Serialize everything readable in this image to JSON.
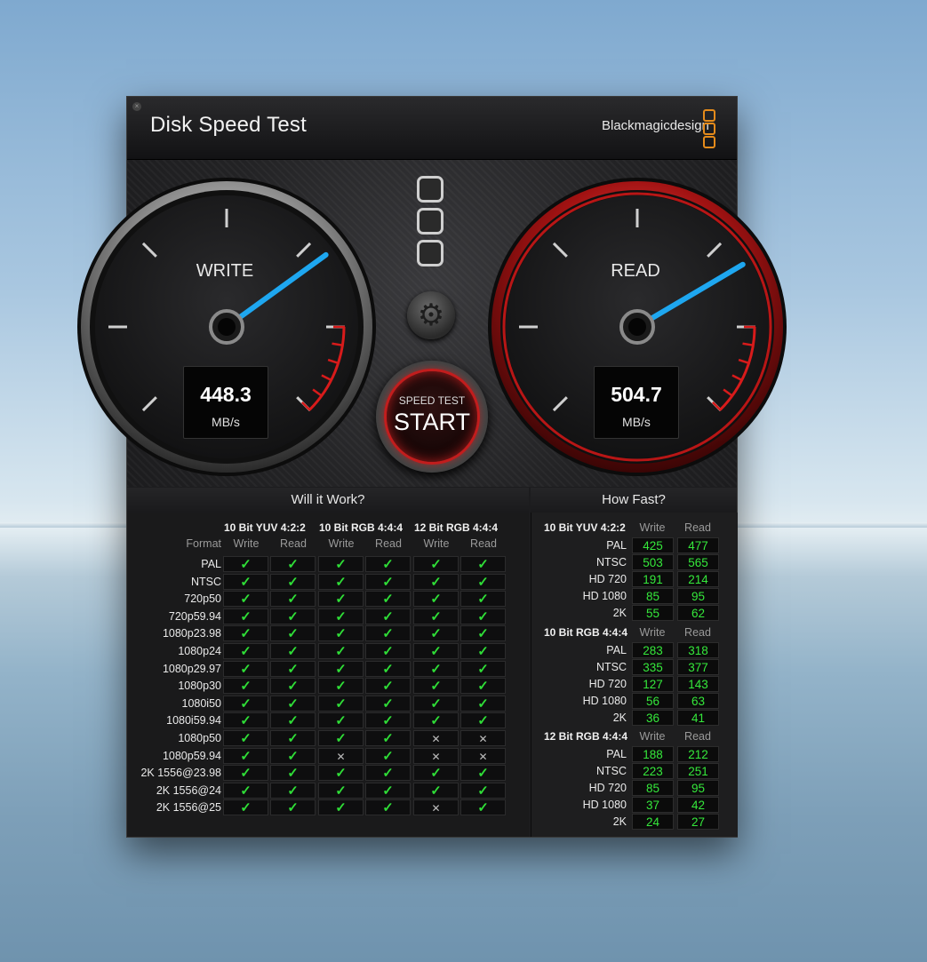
{
  "app": {
    "title": "Disk Speed Test",
    "brand": "Blackmagicdesign"
  },
  "gauges": {
    "write": {
      "label": "WRITE",
      "value": "448.3",
      "unit": "MB/s",
      "needle_fraction": 0.7
    },
    "read": {
      "label": "READ",
      "value": "504.7",
      "unit": "MB/s",
      "needle_fraction": 0.72
    }
  },
  "start_button": {
    "small_label": "SPEED TEST",
    "big_label": "START"
  },
  "will_it_work": {
    "title": "Will it Work?",
    "format_label": "Format",
    "groups": [
      "10 Bit YUV 4:2:2",
      "10 Bit RGB 4:4:4",
      "12 Bit RGB 4:4:4"
    ],
    "sub_labels": [
      "Write",
      "Read"
    ],
    "rows": [
      {
        "format": "PAL",
        "results": [
          true,
          true,
          true,
          true,
          true,
          true
        ]
      },
      {
        "format": "NTSC",
        "results": [
          true,
          true,
          true,
          true,
          true,
          true
        ]
      },
      {
        "format": "720p50",
        "results": [
          true,
          true,
          true,
          true,
          true,
          true
        ]
      },
      {
        "format": "720p59.94",
        "results": [
          true,
          true,
          true,
          true,
          true,
          true
        ]
      },
      {
        "format": "1080p23.98",
        "results": [
          true,
          true,
          true,
          true,
          true,
          true
        ]
      },
      {
        "format": "1080p24",
        "results": [
          true,
          true,
          true,
          true,
          true,
          true
        ]
      },
      {
        "format": "1080p29.97",
        "results": [
          true,
          true,
          true,
          true,
          true,
          true
        ]
      },
      {
        "format": "1080p30",
        "results": [
          true,
          true,
          true,
          true,
          true,
          true
        ]
      },
      {
        "format": "1080i50",
        "results": [
          true,
          true,
          true,
          true,
          true,
          true
        ]
      },
      {
        "format": "1080i59.94",
        "results": [
          true,
          true,
          true,
          true,
          true,
          true
        ]
      },
      {
        "format": "1080p50",
        "results": [
          true,
          true,
          true,
          true,
          false,
          false
        ]
      },
      {
        "format": "1080p59.94",
        "results": [
          true,
          true,
          false,
          true,
          false,
          false
        ]
      },
      {
        "format": "2K 1556@23.98",
        "results": [
          true,
          true,
          true,
          true,
          true,
          true
        ]
      },
      {
        "format": "2K 1556@24",
        "results": [
          true,
          true,
          true,
          true,
          true,
          true
        ]
      },
      {
        "format": "2K 1556@25",
        "results": [
          true,
          true,
          true,
          true,
          false,
          true
        ]
      }
    ],
    "ok_glyph": "✓",
    "fail_glyph": "✕"
  },
  "how_fast": {
    "title": "How Fast?",
    "sub_labels": [
      "Write",
      "Read"
    ],
    "groups": [
      {
        "name": "10 Bit YUV 4:2:2",
        "rows": [
          {
            "format": "PAL",
            "write": "425",
            "read": "477"
          },
          {
            "format": "NTSC",
            "write": "503",
            "read": "565"
          },
          {
            "format": "HD 720",
            "write": "191",
            "read": "214"
          },
          {
            "format": "HD 1080",
            "write": "85",
            "read": "95"
          },
          {
            "format": "2K",
            "write": "55",
            "read": "62"
          }
        ]
      },
      {
        "name": "10 Bit RGB 4:4:4",
        "rows": [
          {
            "format": "PAL",
            "write": "283",
            "read": "318"
          },
          {
            "format": "NTSC",
            "write": "335",
            "read": "377"
          },
          {
            "format": "HD 720",
            "write": "127",
            "read": "143"
          },
          {
            "format": "HD 1080",
            "write": "56",
            "read": "63"
          },
          {
            "format": "2K",
            "write": "36",
            "read": "41"
          }
        ]
      },
      {
        "name": "12 Bit RGB 4:4:4",
        "rows": [
          {
            "format": "PAL",
            "write": "188",
            "read": "212"
          },
          {
            "format": "NTSC",
            "write": "223",
            "read": "251"
          },
          {
            "format": "HD 720",
            "write": "85",
            "read": "95"
          },
          {
            "format": "HD 1080",
            "write": "37",
            "read": "42"
          },
          {
            "format": "2K",
            "write": "24",
            "read": "27"
          }
        ]
      }
    ]
  },
  "colors": {
    "accent_red": "#c21d1d",
    "needle_blue": "#1ea7f0",
    "ok_green": "#2fdd37",
    "logo_orange": "#e58b1b"
  }
}
